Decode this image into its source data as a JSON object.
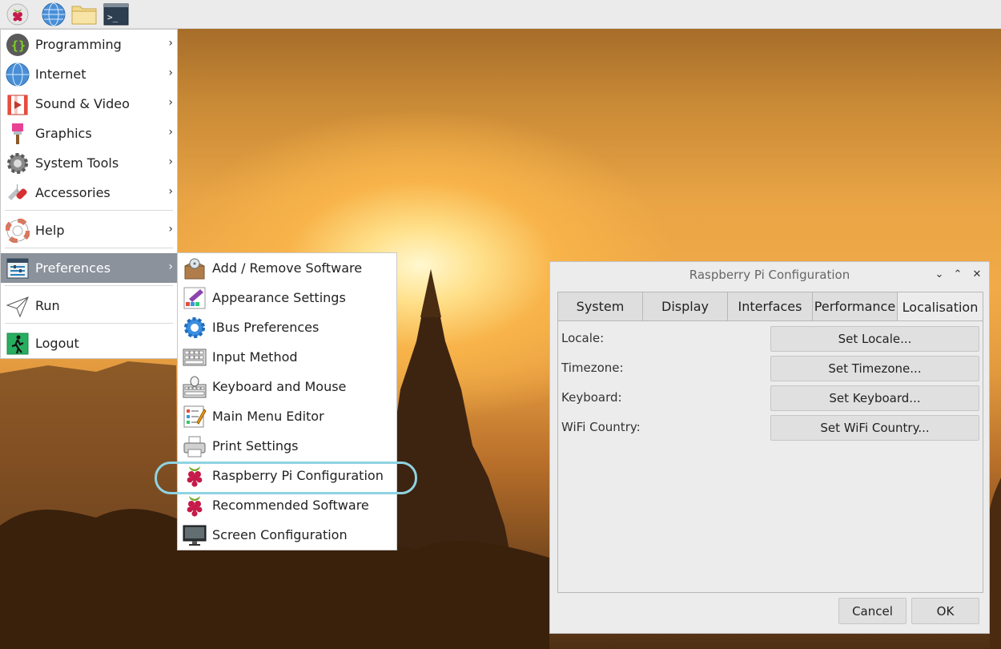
{
  "panel": {
    "icons": [
      "raspberry-menu-icon",
      "web-browser-icon",
      "file-manager-icon",
      "terminal-icon"
    ]
  },
  "main_menu": {
    "items": [
      {
        "label": "Programming",
        "icon": "programming-icon",
        "submenu": true
      },
      {
        "label": "Internet",
        "icon": "globe-icon",
        "submenu": true
      },
      {
        "label": "Sound & Video",
        "icon": "sound-video-icon",
        "submenu": true
      },
      {
        "label": "Graphics",
        "icon": "paintbrush-icon",
        "submenu": true
      },
      {
        "label": "System Tools",
        "icon": "gear-icon",
        "submenu": true
      },
      {
        "label": "Accessories",
        "icon": "pocket-knife-icon",
        "submenu": true
      },
      {
        "label": "Help",
        "icon": "lifebuoy-icon",
        "submenu": true
      },
      {
        "label": "Preferences",
        "icon": "preferences-icon",
        "submenu": true,
        "active": true
      },
      {
        "label": "Run",
        "icon": "paper-plane-icon",
        "submenu": false
      },
      {
        "label": "Logout",
        "icon": "exit-icon",
        "submenu": false
      }
    ],
    "arrow": "›"
  },
  "preferences_menu": {
    "items": [
      {
        "label": "Add / Remove Software",
        "icon": "software-package-icon"
      },
      {
        "label": "Appearance Settings",
        "icon": "appearance-icon"
      },
      {
        "label": "IBus Preferences",
        "icon": "gear-icon"
      },
      {
        "label": "Input Method",
        "icon": "keyboard-grid-icon"
      },
      {
        "label": "Keyboard and Mouse",
        "icon": "keyboard-mouse-icon"
      },
      {
        "label": "Main Menu Editor",
        "icon": "menu-editor-icon"
      },
      {
        "label": "Print Settings",
        "icon": "printer-icon"
      },
      {
        "label": "Raspberry Pi Configuration",
        "icon": "raspberry-icon",
        "highlighted": true
      },
      {
        "label": "Recommended Software",
        "icon": "raspberry-icon"
      },
      {
        "label": "Screen Configuration",
        "icon": "monitor-icon"
      }
    ]
  },
  "dialog": {
    "title": "Raspberry Pi Configuration",
    "window_buttons": {
      "minimize": "⌄",
      "maximize": "⌃",
      "close": "✕"
    },
    "tabs": [
      "System",
      "Display",
      "Interfaces",
      "Performance",
      "Localisation"
    ],
    "active_tab": "Localisation",
    "rows": [
      {
        "label": "Locale:",
        "button": "Set Locale..."
      },
      {
        "label": "Timezone:",
        "button": "Set Timezone..."
      },
      {
        "label": "Keyboard:",
        "button": "Set Keyboard..."
      },
      {
        "label": "WiFi Country:",
        "button": "Set WiFi Country..."
      }
    ],
    "cancel_label": "Cancel",
    "ok_label": "OK"
  },
  "colors": {
    "active_menu_bg": "#8b929b",
    "highlight_ring": "#8fd3e3",
    "raspberry_red": "#c51a4a",
    "raspberry_leaf": "#75a928"
  }
}
